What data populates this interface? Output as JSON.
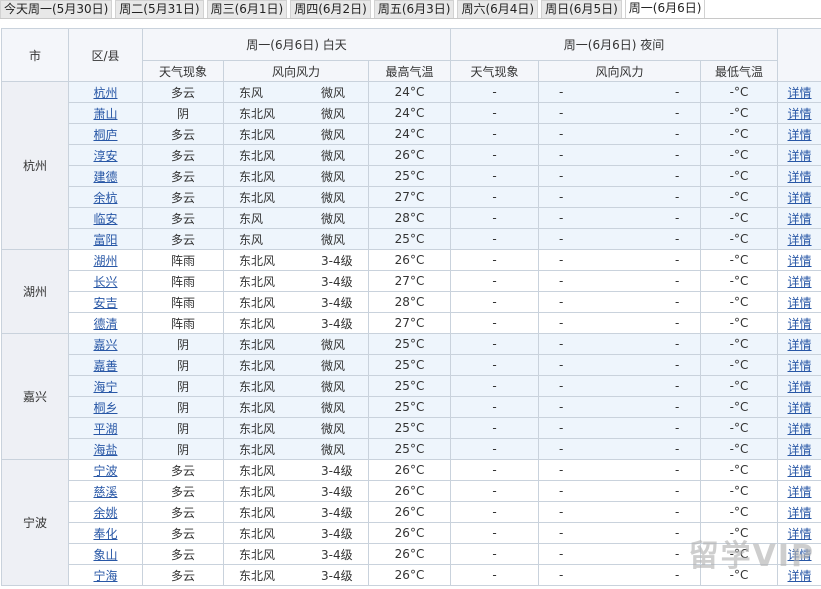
{
  "tabs": [
    "今天周一(5月30日)",
    "周二(5月31日)",
    "周三(6月1日)",
    "周四(6月2日)",
    "周五(6月3日)",
    "周六(6月4日)",
    "周日(6月5日)",
    "周一(6月6日)"
  ],
  "active_tab": 7,
  "headers": {
    "city": "市",
    "district": "区/县",
    "day": "周一(6月6日) 白天",
    "night": "周一(6月6日) 夜间",
    "day_weather": "天气现象",
    "day_wind": "风向风力",
    "day_temp": "最高气温",
    "night_weather": "天气现象",
    "night_wind": "风向风力",
    "night_temp": "最低气温"
  },
  "cities": [
    {
      "name": "杭州",
      "blue": true,
      "rows": [
        {
          "d": "杭州",
          "w": "多云",
          "dir": "东风",
          "pow": "微风",
          "t": "24°C"
        },
        {
          "d": "萧山",
          "w": "阴",
          "dir": "东北风",
          "pow": "微风",
          "t": "24°C"
        },
        {
          "d": "桐庐",
          "w": "多云",
          "dir": "东北风",
          "pow": "微风",
          "t": "24°C"
        },
        {
          "d": "淳安",
          "w": "多云",
          "dir": "东北风",
          "pow": "微风",
          "t": "26°C"
        },
        {
          "d": "建德",
          "w": "多云",
          "dir": "东北风",
          "pow": "微风",
          "t": "25°C"
        },
        {
          "d": "余杭",
          "w": "多云",
          "dir": "东北风",
          "pow": "微风",
          "t": "27°C"
        },
        {
          "d": "临安",
          "w": "多云",
          "dir": "东风",
          "pow": "微风",
          "t": "28°C"
        },
        {
          "d": "富阳",
          "w": "多云",
          "dir": "东风",
          "pow": "微风",
          "t": "25°C"
        }
      ]
    },
    {
      "name": "湖州",
      "blue": false,
      "rows": [
        {
          "d": "湖州",
          "w": "阵雨",
          "dir": "东北风",
          "pow": "3-4级",
          "t": "26°C"
        },
        {
          "d": "长兴",
          "w": "阵雨",
          "dir": "东北风",
          "pow": "3-4级",
          "t": "27°C"
        },
        {
          "d": "安吉",
          "w": "阵雨",
          "dir": "东北风",
          "pow": "3-4级",
          "t": "28°C"
        },
        {
          "d": "德清",
          "w": "阵雨",
          "dir": "东北风",
          "pow": "3-4级",
          "t": "27°C"
        }
      ]
    },
    {
      "name": "嘉兴",
      "blue": true,
      "rows": [
        {
          "d": "嘉兴",
          "w": "阴",
          "dir": "东北风",
          "pow": "微风",
          "t": "25°C"
        },
        {
          "d": "嘉善",
          "w": "阴",
          "dir": "东北风",
          "pow": "微风",
          "t": "25°C"
        },
        {
          "d": "海宁",
          "w": "阴",
          "dir": "东北风",
          "pow": "微风",
          "t": "25°C"
        },
        {
          "d": "桐乡",
          "w": "阴",
          "dir": "东北风",
          "pow": "微风",
          "t": "25°C"
        },
        {
          "d": "平湖",
          "w": "阴",
          "dir": "东北风",
          "pow": "微风",
          "t": "25°C"
        },
        {
          "d": "海盐",
          "w": "阴",
          "dir": "东北风",
          "pow": "微风",
          "t": "25°C"
        }
      ]
    },
    {
      "name": "宁波",
      "blue": false,
      "rows": [
        {
          "d": "宁波",
          "w": "多云",
          "dir": "东北风",
          "pow": "3-4级",
          "t": "26°C"
        },
        {
          "d": "慈溪",
          "w": "多云",
          "dir": "东北风",
          "pow": "3-4级",
          "t": "26°C"
        },
        {
          "d": "余姚",
          "w": "多云",
          "dir": "东北风",
          "pow": "3-4级",
          "t": "26°C"
        },
        {
          "d": "奉化",
          "w": "多云",
          "dir": "东北风",
          "pow": "3-4级",
          "t": "26°C"
        },
        {
          "d": "象山",
          "w": "多云",
          "dir": "东北风",
          "pow": "3-4级",
          "t": "26°C"
        },
        {
          "d": "宁海",
          "w": "多云",
          "dir": "东北风",
          "pow": "3-4级",
          "t": "26°C"
        }
      ]
    }
  ],
  "night_placeholder": "-",
  "night_temp": "-°C",
  "detail_label": "详情",
  "colors": {
    "row_blue": "#eef5fc",
    "link": "#2857a6",
    "border": "#c9d2dc"
  }
}
